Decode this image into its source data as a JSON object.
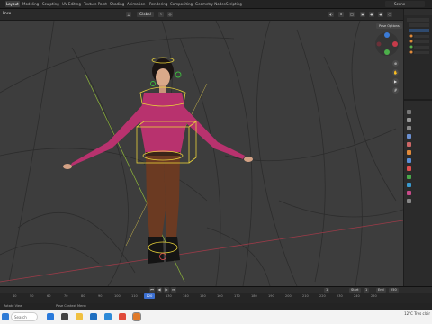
{
  "topbar": {
    "tabs": [
      "Layout",
      "Modeling",
      "Sculpting",
      "UV Editing",
      "Texture Paint",
      "Shading",
      "Animation",
      "Rendering",
      "Compositing",
      "Geometry Nodes",
      "Scripting"
    ],
    "active_tab": "Layout",
    "scene": "Scene"
  },
  "viewport_header": {
    "mode": "Pose",
    "orientation": "Global"
  },
  "viewport": {
    "pose_options": "Pose Options"
  },
  "timeline": {
    "ticks": [
      "40",
      "50",
      "60",
      "70",
      "80",
      "90",
      "100",
      "110",
      "120",
      "130",
      "140",
      "150",
      "160",
      "170",
      "180",
      "190",
      "200",
      "210",
      "220",
      "230",
      "240",
      "250"
    ],
    "current_frame": "120",
    "start_label": "Start",
    "start_value": "1",
    "end_label": "End",
    "end_value": "250",
    "frame_field": "1"
  },
  "status": {
    "left": "Rotate View",
    "middle": "Pose Context Menu"
  },
  "taskbar": {
    "search_placeholder": "Search",
    "weather": "12°C  Très clair"
  },
  "colors": {
    "accent": "#3b6fd1",
    "bone_yellow": "#e8d23a",
    "shirt": "#b8326e"
  }
}
